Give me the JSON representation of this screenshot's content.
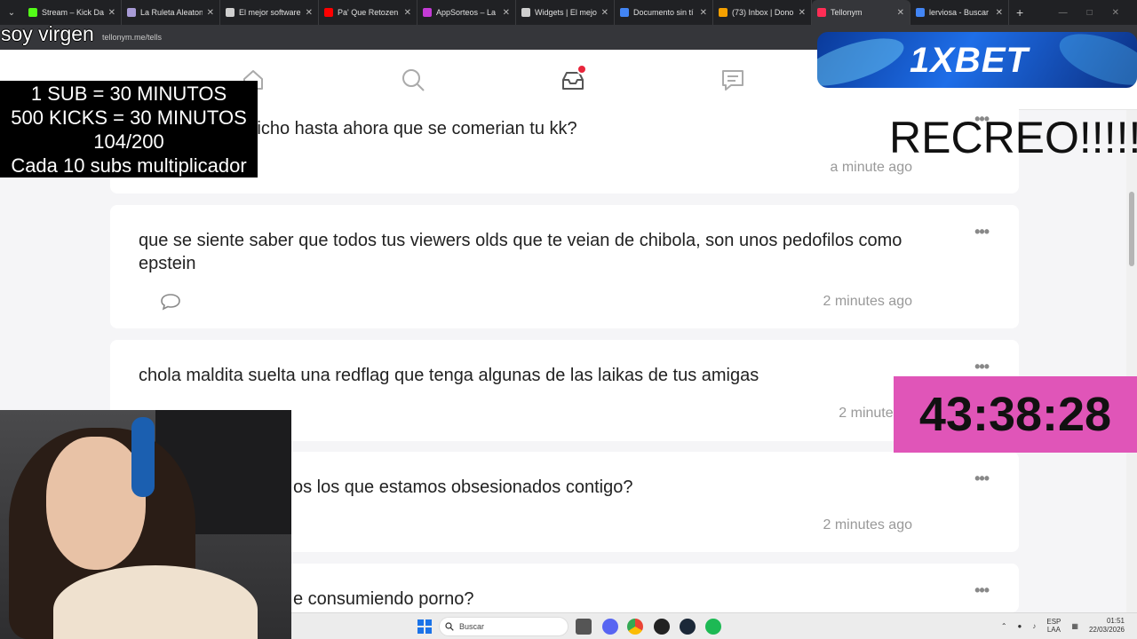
{
  "browser": {
    "tabs": [
      {
        "title": "Stream – Kick Da",
        "fav": "#53fc18"
      },
      {
        "title": "La Ruleta Aleaton",
        "fav": "#a89bd6"
      },
      {
        "title": "El mejor software",
        "fav": "#cfcfcf"
      },
      {
        "title": "Pa' Que Retozen",
        "fav": "#ff0000"
      },
      {
        "title": "AppSorteos – La",
        "fav": "#c43bd6"
      },
      {
        "title": "Widgets | El mejo",
        "fav": "#cfcfcf"
      },
      {
        "title": "Documento sin tí",
        "fav": "#4285f4"
      },
      {
        "title": "(73) Inbox | Dono",
        "fav": "#f4a000"
      },
      {
        "title": "Tellonym",
        "fav": "#ff2d55"
      },
      {
        "title": "lerviosa - Buscar",
        "fav": "#4285f4"
      }
    ],
    "active_tab": 8,
    "close_glyph": "✕",
    "new_tab_glyph": "+",
    "url": "tellonym.me/tells"
  },
  "feed": {
    "cards": [
      {
        "text": "...ores te han dicho hasta ahora que se comerian tu kk?",
        "time": "a minute ago"
      },
      {
        "text": "que se siente saber que todos tus viewers olds que te veian de chibola, son unos pedofilos como epstein",
        "time": "2 minutes ago"
      },
      {
        "text": "chola maldita suelta una redflag que tenga algunas de las laikas de tus amigas",
        "time": "2 minutes a"
      },
      {
        "text": "os los que estamos obsesionados contigo?",
        "time": "2 minutes ago"
      },
      {
        "text": "e consumiendo porno?",
        "time": ""
      }
    ],
    "more_glyph": "•••"
  },
  "overlays": {
    "title": "soy virgen",
    "subs_rules": [
      "1 SUB     = 30 MINUTOS",
      "500 KICKS = 30 MINUTOS",
      "104/200",
      "Cada 10 subs multiplicador"
    ],
    "banner_text": "1XBET",
    "recreo": "RECREO!!!!!",
    "timer": "43:38:28"
  },
  "taskbar": {
    "search_placeholder": "Buscar",
    "lang_top": "ESP",
    "lang_bottom": "LAA",
    "time": "01:51",
    "date": "22/03/2026"
  },
  "colors": {
    "accent": "#e8253b",
    "timer_bg": "#e055b8",
    "banner": "#1e6ee8"
  }
}
